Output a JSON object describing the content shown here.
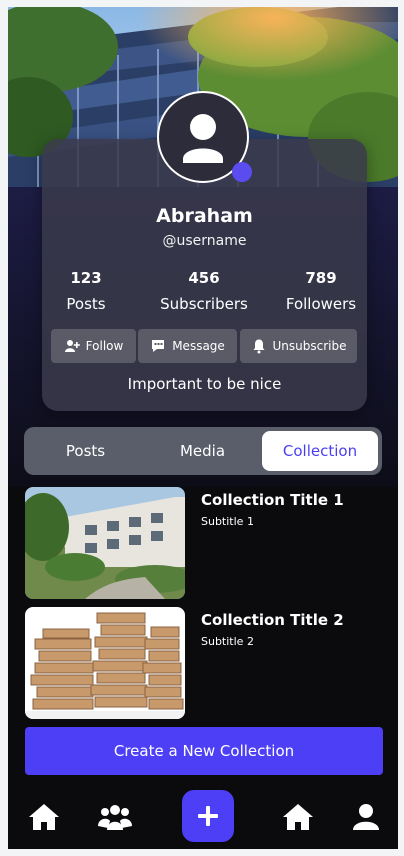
{
  "profile": {
    "name": "Abraham",
    "handle": "@username",
    "tagline": "Important to be nice"
  },
  "stats": [
    {
      "value": "123",
      "label": "Posts"
    },
    {
      "value": "456",
      "label": "Subscribers"
    },
    {
      "value": "789",
      "label": "Followers"
    }
  ],
  "actions": {
    "follow": "Follow",
    "message": "Message",
    "unsubscribe": "Unsubscribe"
  },
  "tabs": [
    {
      "label": "Posts",
      "active": false
    },
    {
      "label": "Media",
      "active": false
    },
    {
      "label": "Collection",
      "active": true
    }
  ],
  "collections": [
    {
      "title": "Collection Title 1",
      "subtitle": "Subtitle 1"
    },
    {
      "title": "Collection Title 2",
      "subtitle": "Subtitle 2"
    }
  ],
  "create_button": "Create a New Collection",
  "nav": [
    "home-icon",
    "group-icon",
    "plus-icon",
    "home-icon",
    "user-icon"
  ],
  "colors": {
    "accent": "#4d3ff5",
    "card": "#3a3a4c",
    "button": "#5b5b68",
    "tabs_bg": "#5a5d6a"
  }
}
